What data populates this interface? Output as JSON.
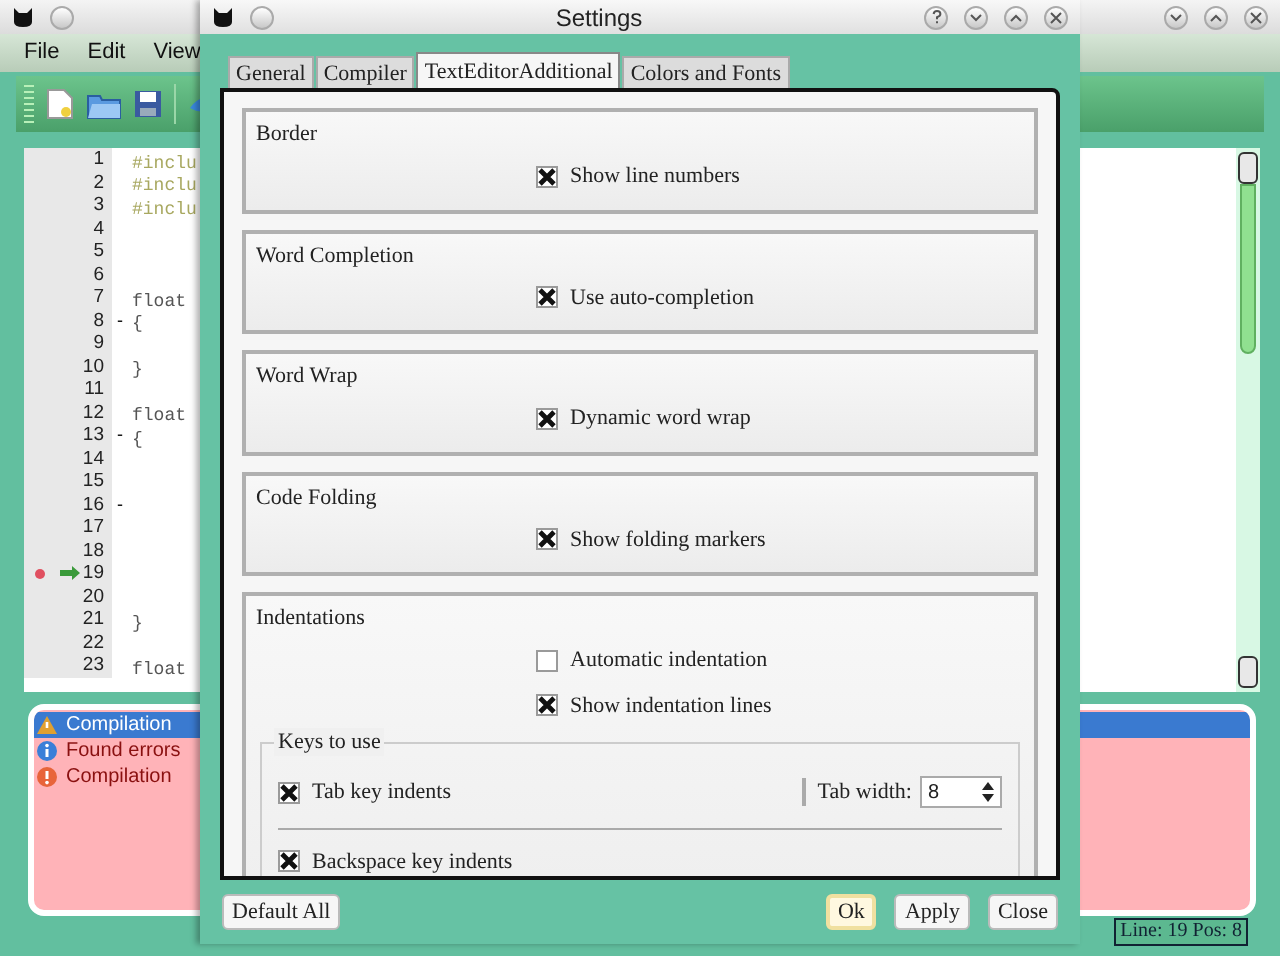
{
  "main_window": {
    "menu": [
      "File",
      "Edit",
      "View"
    ],
    "editor": {
      "lines": [
        {
          "number": "1",
          "code": "#inclu",
          "breakpoint": false,
          "current": false
        },
        {
          "number": "2",
          "code": "#inclu",
          "breakpoint": false,
          "current": false
        },
        {
          "number": "3",
          "code": "#inclu",
          "breakpoint": false,
          "current": false
        },
        {
          "number": "4",
          "breakpoint": false,
          "current": false
        },
        {
          "number": "5",
          "breakpoint": false,
          "current": false
        },
        {
          "number": "6",
          "breakpoint": false,
          "current": false
        },
        {
          "number": "7",
          "code": "float",
          "breakpoint": false,
          "current": false
        },
        {
          "number": "8",
          "code": "{",
          "fold": "-",
          "breakpoint": false,
          "current": false
        },
        {
          "number": "9",
          "breakpoint": false,
          "current": false
        },
        {
          "number": "10",
          "code": "}",
          "breakpoint": false,
          "current": false
        },
        {
          "number": "11",
          "breakpoint": false,
          "current": false
        },
        {
          "number": "12",
          "code": "float",
          "breakpoint": false,
          "current": false
        },
        {
          "number": "13",
          "code": "{",
          "fold": "-",
          "breakpoint": false,
          "current": false
        },
        {
          "number": "14",
          "breakpoint": false,
          "current": false
        },
        {
          "number": "15",
          "breakpoint": false,
          "current": false
        },
        {
          "number": "16",
          "fold": "-",
          "breakpoint": false,
          "current": false
        },
        {
          "number": "17",
          "breakpoint": false,
          "current": false
        },
        {
          "number": "18",
          "breakpoint": false,
          "current": false
        },
        {
          "number": "19",
          "breakpoint": true,
          "current": true
        },
        {
          "number": "20",
          "breakpoint": false,
          "current": false
        },
        {
          "number": "21",
          "code": "}",
          "breakpoint": false,
          "current": false
        },
        {
          "number": "22",
          "breakpoint": false,
          "current": false
        },
        {
          "number": "23",
          "code": "float",
          "breakpoint": false,
          "current": false
        }
      ]
    },
    "messages": [
      {
        "text": "Compilation",
        "kind": "warning",
        "selected": true
      },
      {
        "text": "Found errors",
        "kind": "info",
        "selected": false
      },
      {
        "text": "Compilation",
        "kind": "error",
        "selected": false
      }
    ],
    "status": "Line: 19 Pos: 8"
  },
  "dialog": {
    "title": "Settings",
    "tabs": [
      {
        "label": "General",
        "selected": false
      },
      {
        "label": "Compiler",
        "selected": false
      },
      {
        "label": "TextEditorAdditional",
        "selected": true
      },
      {
        "label": "Colors and Fonts",
        "selected": false
      }
    ],
    "groups": [
      {
        "title": "Border",
        "options": [
          {
            "label": "Show line numbers",
            "checked": true
          }
        ]
      },
      {
        "title": "Word Completion",
        "options": [
          {
            "label": "Use auto-completion",
            "checked": true
          }
        ]
      },
      {
        "title": "Word Wrap",
        "options": [
          {
            "label": "Dynamic word wrap",
            "checked": true
          }
        ]
      },
      {
        "title": "Code Folding",
        "options": [
          {
            "label": "Show folding markers",
            "checked": true
          }
        ]
      },
      {
        "title": "Indentations",
        "options": [
          {
            "label": "Automatic indentation",
            "checked": false
          },
          {
            "label": "Show indentation lines",
            "checked": true
          }
        ],
        "subgroup": {
          "title": "Keys to use",
          "options": [
            {
              "label": "Tab key indents",
              "checked": true
            },
            {
              "label": "Backspace key indents",
              "checked": true
            }
          ],
          "tab_width": {
            "label": "Tab width:",
            "value": "8"
          }
        }
      }
    ],
    "buttons": [
      {
        "label": "Default All",
        "default": false
      },
      {
        "label": "Ok",
        "default": true
      },
      {
        "label": "Apply",
        "default": false
      },
      {
        "label": "Close",
        "default": false
      }
    ]
  }
}
